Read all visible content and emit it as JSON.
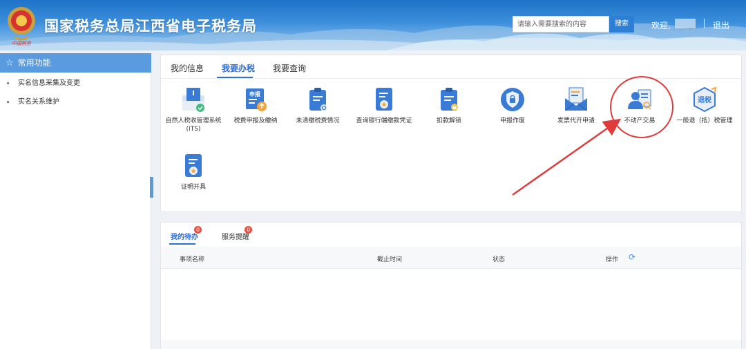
{
  "header": {
    "title": "国家税务总局江西省电子税务局",
    "search_placeholder": "请输入需要搜索的内容",
    "search_button": "搜索",
    "welcome": "欢迎,",
    "logout": "退出"
  },
  "sidebar": {
    "head": "常用功能",
    "items": [
      {
        "label": "实名信息采集及变更"
      },
      {
        "label": "实名关系维护"
      }
    ]
  },
  "tabs": [
    {
      "label": "我的信息"
    },
    {
      "label": "我要办税",
      "active": true
    },
    {
      "label": "我要查询"
    }
  ],
  "functions": [
    {
      "label": "自然人税收管理系统(ITS)",
      "icon": "its-icon"
    },
    {
      "label": "税费申报及缴纳",
      "icon": "declare-pay-icon"
    },
    {
      "label": "未清缴税费情况",
      "icon": "unpaid-tax-icon"
    },
    {
      "label": "查询银行端缴款凭证",
      "icon": "bank-voucher-icon"
    },
    {
      "label": "扣款解锁",
      "icon": "deduction-unlock-icon"
    },
    {
      "label": "申报作废",
      "icon": "void-declare-icon"
    },
    {
      "label": "发票代开申请",
      "icon": "invoice-icon"
    },
    {
      "label": "不动产交易",
      "icon": "real-estate-icon"
    },
    {
      "label": "一般退（抵）税管理",
      "icon": "refund-icon",
      "icon_text": "退税"
    },
    {
      "label": "证明开具",
      "icon": "certificate-icon"
    }
  ],
  "icon_text": {
    "declare": "申报"
  },
  "bottom": {
    "tabs": [
      {
        "label": "我的待办",
        "badge": "0",
        "active": true
      },
      {
        "label": "服务提醒",
        "badge": "0"
      }
    ],
    "columns": [
      "事项名称",
      "截止时间",
      "状态",
      "操作"
    ]
  },
  "colors": {
    "accent": "#2c6fd3",
    "sidebar_head": "#5a9be0",
    "annotation": "#e03b3b",
    "badge": "#e84c3d"
  }
}
